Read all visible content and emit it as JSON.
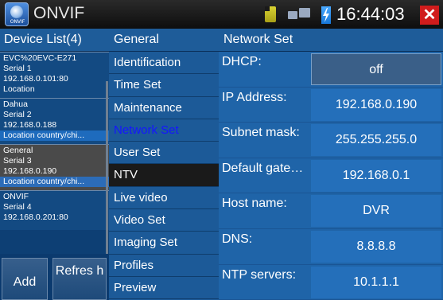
{
  "app": {
    "title": "ONVIF",
    "logo_text": "ONVIF",
    "time": "16:44:03"
  },
  "icons": {
    "sd": "sd-card-icon",
    "network": "network-icon",
    "battery": "battery-charging-icon",
    "close": "close-icon"
  },
  "colors": {
    "close": "#d01c1c",
    "active_menu": "#1515ff",
    "selected_device": "#4a4a4a"
  },
  "device_list": {
    "header": "Device List(4)",
    "devices": [
      {
        "name": "EVC%20EVC-E271",
        "serial": "Serial 1",
        "ip": "192.168.0.101:80",
        "location": "Location"
      },
      {
        "name": "Dahua",
        "serial": "Serial 2",
        "ip": "192.168.0.188",
        "location": "Location country/chi..."
      },
      {
        "name": "General",
        "serial": "Serial 3",
        "ip": "192.168.0.190",
        "location": "Location country/chi..."
      },
      {
        "name": "ONVIF",
        "serial": "Serial 4",
        "ip": "192.168.0.201:80",
        "location": ""
      }
    ],
    "add_label": "Add",
    "refresh_label": "Refres h"
  },
  "menu": {
    "header": "General",
    "items": [
      "Identification",
      "Time Set",
      "Maintenance",
      "Network Set",
      "User Set",
      "NTV",
      "Live video",
      "Video Set",
      "Imaging Set",
      "Profiles",
      "Preview"
    ]
  },
  "network": {
    "header": "Network Set",
    "rows": [
      {
        "label": "DHCP:",
        "value": "off"
      },
      {
        "label": "IP Address:",
        "value": "192.168.0.190"
      },
      {
        "label": "Subnet mask:",
        "value": "255.255.255.0"
      },
      {
        "label": "Default gate…",
        "value": "192.168.0.1"
      },
      {
        "label": "Host name:",
        "value": "DVR"
      },
      {
        "label": "DNS:",
        "value": "8.8.8.8"
      },
      {
        "label": "NTP servers:",
        "value": "10.1.1.1"
      }
    ]
  }
}
